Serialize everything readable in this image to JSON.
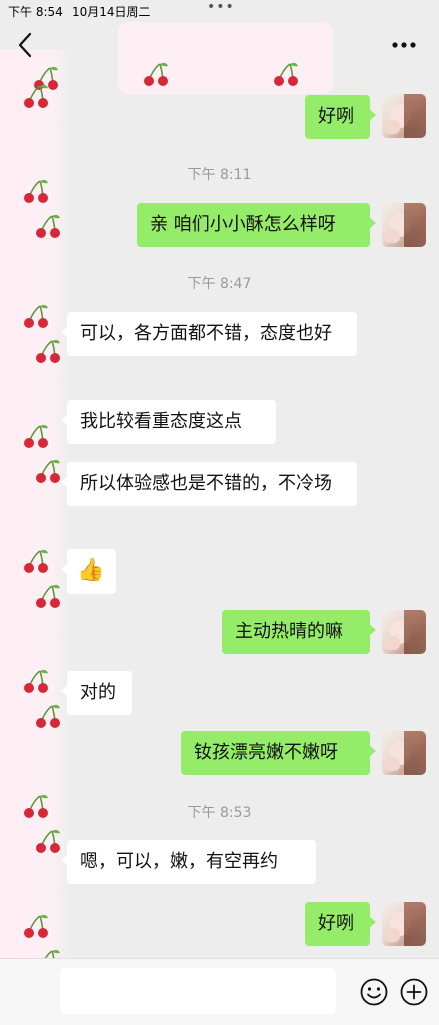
{
  "status_bar": {
    "time": "下午 8:54",
    "date": "10月14日周二",
    "dots": "•••"
  },
  "header": {
    "back_icon": "chevron-left-icon",
    "more_icon": "more-horizontal-icon",
    "more_label": "•••"
  },
  "messages": [
    {
      "kind": "outgoing",
      "text": "好咧"
    },
    {
      "kind": "time",
      "text": "下午 8:11"
    },
    {
      "kind": "outgoing",
      "text": "亲 咱们小小酥怎么样呀"
    },
    {
      "kind": "time",
      "text": "下午 8:47"
    },
    {
      "kind": "incoming",
      "text": "可以，各方面都不错，态度也好"
    },
    {
      "kind": "incoming",
      "text": "我比较看重态度这点"
    },
    {
      "kind": "incoming",
      "text": "所以体验感也是不错的，不冷场"
    },
    {
      "kind": "incoming",
      "text": "👍",
      "icon": "thumbs-up-icon"
    },
    {
      "kind": "outgoing",
      "text": "主动热晴的嘛"
    },
    {
      "kind": "incoming",
      "text": "对的"
    },
    {
      "kind": "outgoing",
      "text": "钕孩漂亮嫩不嫩呀"
    },
    {
      "kind": "time",
      "text": "下午 8:53"
    },
    {
      "kind": "incoming",
      "text": "嗯，可以，嫩，有空再约"
    },
    {
      "kind": "outgoing",
      "text": "好咧"
    }
  ],
  "input_bar": {
    "emoji_icon": "smiley-face-icon",
    "plus_icon": "plus-circle-icon"
  },
  "colors": {
    "outgoing_bubble": "#95ec69",
    "incoming_bubble": "#ffffff",
    "background": "#ededed",
    "cherry": "#d62839"
  }
}
